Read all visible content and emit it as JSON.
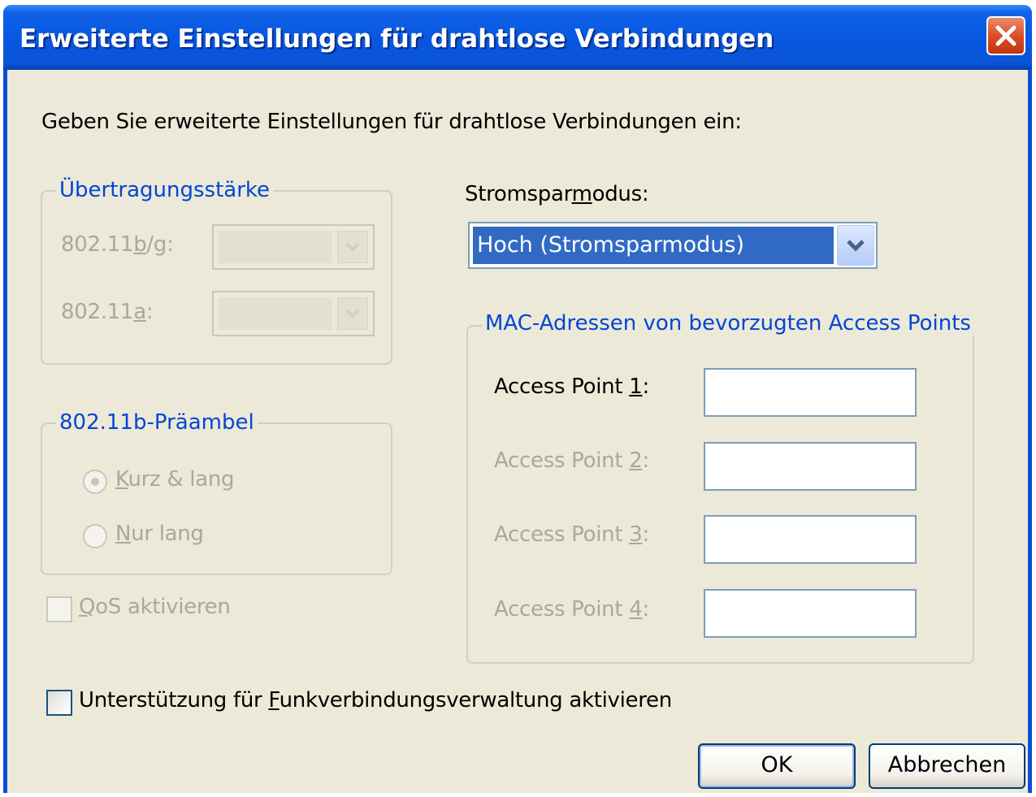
{
  "window": {
    "title": "Erweiterte Einstellungen für drahtlose Verbindungen",
    "close_icon": "close-icon"
  },
  "intro": "Geben Sie erweiterte Einstellungen für drahtlose Verbindungen ein:",
  "transmit_power": {
    "legend": "Übertragungsstärke",
    "bg_label_pre": "802.11",
    "bg_label_u": "b",
    "bg_label_post": "/g:",
    "a_label_pre": "802.11",
    "a_label_u": "a",
    "a_label_post": ":"
  },
  "preamble": {
    "legend": "802.11b-Präambel",
    "short_long_u": "K",
    "short_long_rest": "urz & lang",
    "long_only_u": "N",
    "long_only_rest": "ur lang"
  },
  "qos": {
    "label_u": "Q",
    "label_rest": "oS aktivieren"
  },
  "power_saving": {
    "label_pre": "Stromspar",
    "label_u": "m",
    "label_post": "odus:",
    "selected": "Hoch (Stromsparmodus)"
  },
  "mac": {
    "legend": "MAC-Adressen von bevorzugten Access Points",
    "ap1_pre": "Access Point ",
    "ap1_u": "1",
    "ap1_post": ":",
    "ap2_pre": "Access Point ",
    "ap2_u": "2",
    "ap2_post": ":",
    "ap3_pre": "Access Point ",
    "ap3_u": "3",
    "ap3_post": ":",
    "ap4_pre": "Access Point ",
    "ap4_u": "4",
    "ap4_post": ":",
    "values": [
      "",
      "",
      "",
      ""
    ]
  },
  "radio_mgmt": {
    "label_pre": "Unterstützung für ",
    "label_u": "F",
    "label_post": "unkverbindungsverwaltung aktivieren"
  },
  "buttons": {
    "ok": "OK",
    "cancel": "Abbrechen"
  },
  "colors": {
    "titlebar": "#0a55d8",
    "face": "#ece9d8",
    "legend": "#0046d5",
    "disabled": "#aca899",
    "selection": "#316ac5"
  }
}
